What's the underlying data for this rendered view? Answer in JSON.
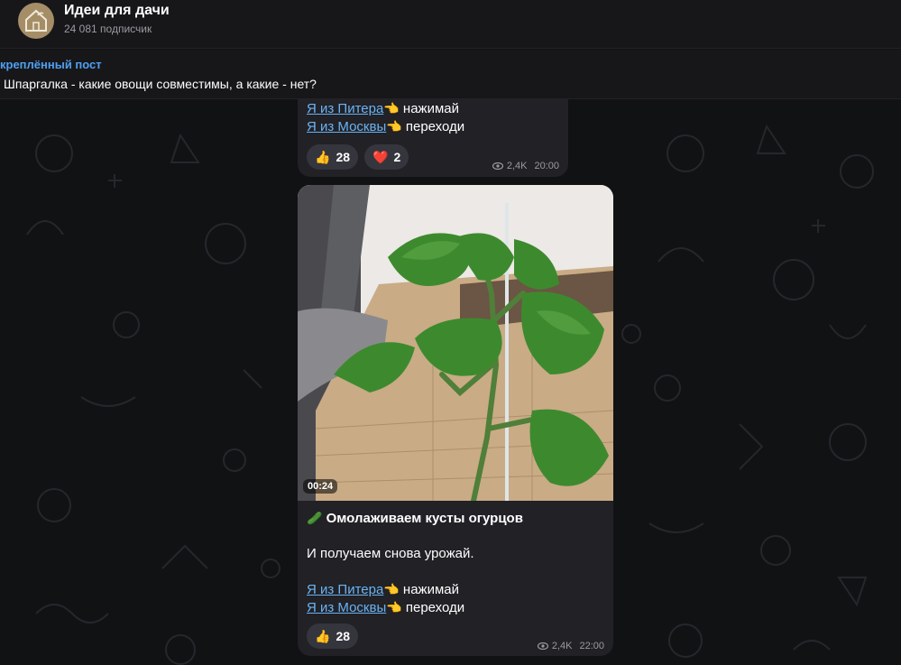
{
  "channel": {
    "title": "Идеи для дачи",
    "subscribers": "24 081 подписчик"
  },
  "pinned": {
    "label": "креплённый пост",
    "text": "Шпаргалка - какие овощи совместимы, а какие - нет?"
  },
  "messages": [
    {
      "link_piter": "Я из Питера",
      "action_piter": "нажимай",
      "link_moscow": "Я из Москвы",
      "action_moscow": "переходи",
      "reactions": [
        {
          "emoji": "👍",
          "count": "28"
        },
        {
          "emoji": "❤️",
          "count": "2"
        }
      ],
      "views": "2,4K",
      "time": "20:00"
    },
    {
      "video_duration": "00:24",
      "title_emoji": "🥒",
      "title": "Омолаживаем кусты огурцов",
      "body": "И получаем снова урожай.",
      "link_piter": "Я из Питера",
      "action_piter": "нажимай",
      "link_moscow": "Я из Москвы",
      "action_moscow": "переходи",
      "reactions": [
        {
          "emoji": "👍",
          "count": "28"
        }
      ],
      "views": "2,4K",
      "time": "22:00"
    }
  ],
  "icons": {
    "pointing_hand": "👈",
    "eye": "eye-icon"
  },
  "colors": {
    "link": "#6ab3f3",
    "pinned_label": "#4ea0f0",
    "bubble": "#212126",
    "background": "#111214"
  }
}
